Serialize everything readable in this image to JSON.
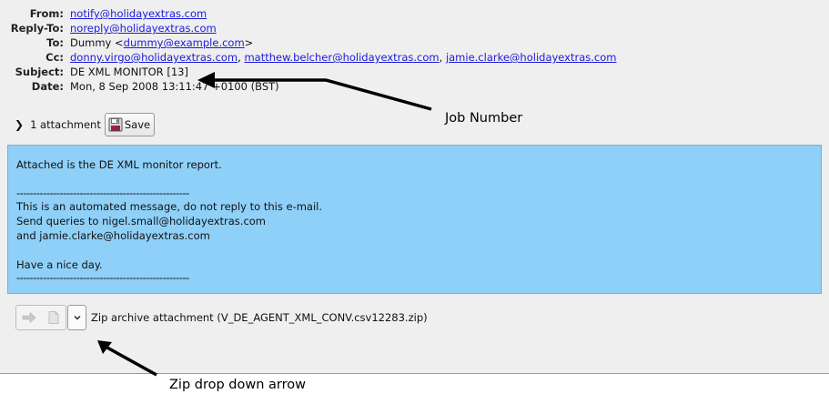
{
  "header": {
    "from_label": "From:",
    "from_value": "notify@holidayextras.com",
    "replyto_label": "Reply-To:",
    "replyto_value": "noreply@holidayextras.com",
    "to_label": "To:",
    "to_name": "Dummy <",
    "to_email": "dummy@example.com",
    "to_close": ">",
    "cc_label": "Cc:",
    "cc_1": "donny.virgo@holidayextras.com",
    "cc_2": "matthew.belcher@holidayextras.com",
    "cc_3": "jamie.clarke@holidayextras.com",
    "subject_label": "Subject:",
    "subject_value": "DE XML MONITOR [13]",
    "date_label": "Date:",
    "date_value": "Mon, 8 Sep 2008 13:11:47 +0100 (BST)"
  },
  "attachments": {
    "toggle_icon": "chevron-right-icon",
    "count_label": "1 attachment",
    "save_label": "Save"
  },
  "message_body": {
    "line1": "Attached is the DE XML monitor report.",
    "rule1": "----------------------------------------------------",
    "line2": "This is an automated message, do not reply to this e-mail.",
    "line3": "Send queries to nigel.small@holidayextras.com",
    "line4": "and jamie.clarke@holidayextras.com",
    "line5": "Have a nice day.",
    "rule2": "----------------------------------------------------"
  },
  "attachment_bar": {
    "label": "Zip archive attachment (V_DE_AGENT_XML_CONV.csv12283.zip)"
  },
  "annotations": {
    "job_number": "Job Number",
    "zip_dropdown": "Zip drop down arrow"
  },
  "colors": {
    "body_background": "#8fd0f8",
    "link": "#1a1adc",
    "panel": "#efefef"
  }
}
